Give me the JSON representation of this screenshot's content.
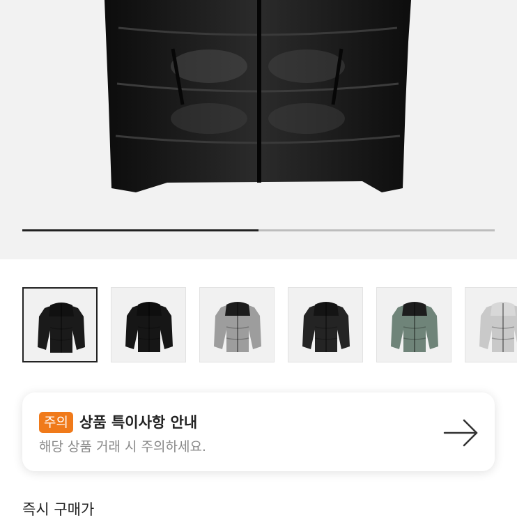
{
  "gallery": {
    "progress_fraction": 0.5,
    "thumbnails": [
      {
        "label": "black-shiny-front",
        "color": "#1a1a1a",
        "shoulder": "#111111"
      },
      {
        "label": "black-shiny-angle",
        "color": "#161616",
        "shoulder": "#0e0e0e"
      },
      {
        "label": "grey-black-shoulder",
        "color": "#9d9d9d",
        "shoulder": "#1c1c1c"
      },
      {
        "label": "black-matte",
        "color": "#242424",
        "shoulder": "#141414"
      },
      {
        "label": "green-black-shoulder",
        "color": "#6f8479",
        "shoulder": "#1d1d1d"
      },
      {
        "label": "silver-camo",
        "color": "#c9c9c9",
        "shoulder": "#d8d8d8"
      }
    ]
  },
  "notice": {
    "badge": "주의",
    "title": "상품 특이사항 안내",
    "description": "해당 상품 거래 시 주의하세요."
  },
  "section": {
    "title": "즉시 구매가"
  },
  "colors": {
    "badge_orange": "#f07a1a",
    "progress_active": "#222222",
    "progress_track": "#bdbdbd"
  }
}
